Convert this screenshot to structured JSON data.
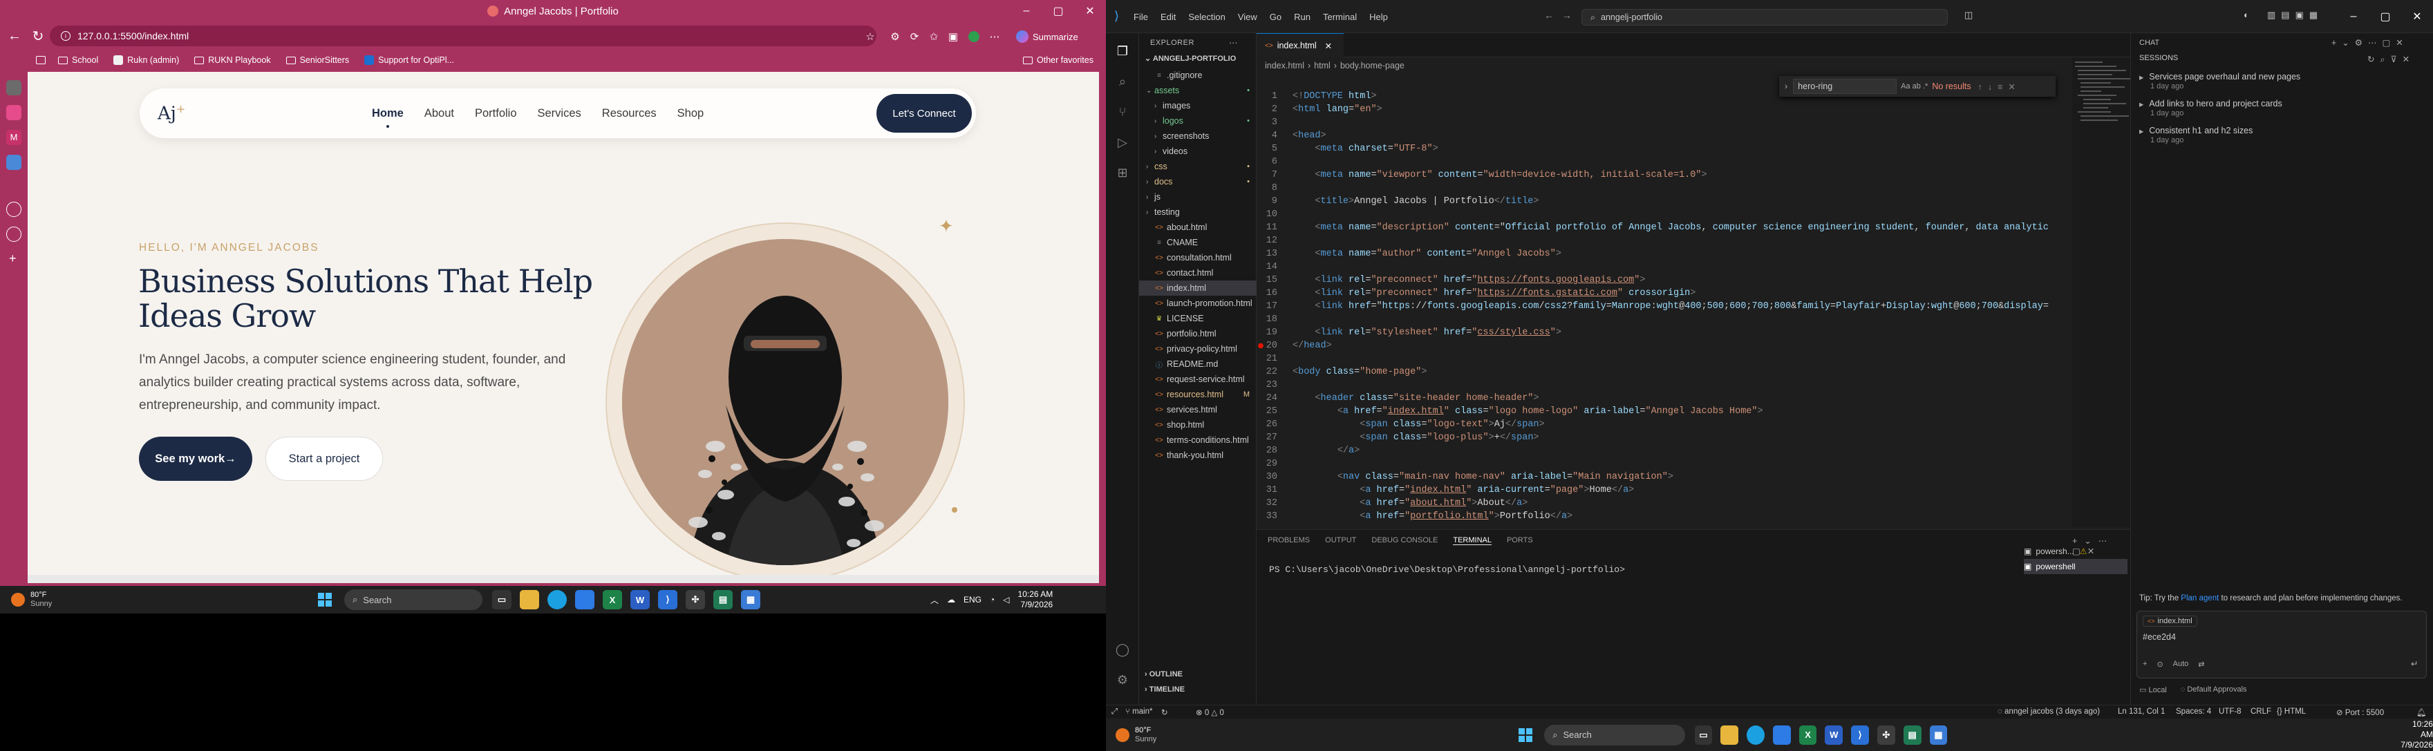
{
  "browser": {
    "window_title": "Anngel Jacobs | Portfolio",
    "url": "127.0.0.1:5500/index.html",
    "summarize_label": "Summarize",
    "bookmarks": [
      "School",
      "Rukn (admin)",
      "RUKN Playbook",
      "SeniorSitters",
      "Support for OptiPl..."
    ],
    "other_favorites": "Other favorites",
    "colors": {
      "frame": "#a8325f",
      "navy": "#1c2a45",
      "gold": "#c9a267"
    }
  },
  "site": {
    "logo": "Aj",
    "logo_plus": "+",
    "nav": [
      "Home",
      "About",
      "Portfolio",
      "Services",
      "Resources",
      "Shop"
    ],
    "cta": "Let's Connect",
    "eyebrow": "HELLO, I'M ANNGEL JACOBS",
    "title": "Business Solutions That Help Ideas Grow",
    "text": "I'm Anngel Jacobs, a computer science engineering student, founder, and analytics builder creating practical systems across data, software, entrepreneurship, and community impact.",
    "primary_button": "See my work→",
    "secondary_button": "Start a project"
  },
  "taskbar_left": {
    "weather_temp": "80°F",
    "weather_desc": "Sunny",
    "search": "Search",
    "lang": "ENG",
    "time": "10:26 AM",
    "date": "7/9/2026"
  },
  "vscode": {
    "menu": [
      "File",
      "Edit",
      "Selection",
      "View",
      "Go",
      "Run",
      "Terminal",
      "Help"
    ],
    "command_center": "anngelj-portfolio",
    "explorer_title": "EXPLORER",
    "project": "ANNGELJ-PORTFOLIO",
    "tree": [
      {
        "name": ".gitignore",
        "depth": 1,
        "type": "file",
        "color": "#cccccc"
      },
      {
        "name": "assets",
        "depth": 1,
        "type": "folder-open",
        "color": "#73c991",
        "badge": "•"
      },
      {
        "name": "images",
        "depth": 2,
        "type": "folder",
        "color": "#cccccc"
      },
      {
        "name": "logos",
        "depth": 2,
        "type": "folder",
        "color": "#73c991",
        "badge": "•"
      },
      {
        "name": "screenshots",
        "depth": 2,
        "type": "folder",
        "color": "#cccccc"
      },
      {
        "name": "videos",
        "depth": 2,
        "type": "folder",
        "color": "#cccccc"
      },
      {
        "name": "css",
        "depth": 1,
        "type": "folder",
        "color": "#e2c08d",
        "badge": "•"
      },
      {
        "name": "docs",
        "depth": 1,
        "type": "folder",
        "color": "#e2c08d",
        "badge": "•"
      },
      {
        "name": "js",
        "depth": 1,
        "type": "folder",
        "color": "#cccccc"
      },
      {
        "name": "testing",
        "depth": 1,
        "type": "folder",
        "color": "#cccccc"
      },
      {
        "name": "about.html",
        "depth": 1,
        "type": "html",
        "color": "#cccccc"
      },
      {
        "name": "CNAME",
        "depth": 1,
        "type": "file",
        "color": "#cccccc"
      },
      {
        "name": "consultation.html",
        "depth": 1,
        "type": "html",
        "color": "#cccccc"
      },
      {
        "name": "contact.html",
        "depth": 1,
        "type": "html",
        "color": "#cccccc"
      },
      {
        "name": "index.html",
        "depth": 1,
        "type": "html",
        "color": "#cccccc",
        "selected": true
      },
      {
        "name": "launch-promotion.html",
        "depth": 1,
        "type": "html",
        "color": "#cccccc"
      },
      {
        "name": "LICENSE",
        "depth": 1,
        "type": "license",
        "color": "#cccccc"
      },
      {
        "name": "portfolio.html",
        "depth": 1,
        "type": "html",
        "color": "#cccccc"
      },
      {
        "name": "privacy-policy.html",
        "depth": 1,
        "type": "html",
        "color": "#cccccc"
      },
      {
        "name": "README.md",
        "depth": 1,
        "type": "md",
        "color": "#cccccc"
      },
      {
        "name": "request-service.html",
        "depth": 1,
        "type": "html",
        "color": "#cccccc"
      },
      {
        "name": "resources.html",
        "depth": 1,
        "type": "html",
        "color": "#e2c08d",
        "badge": "M"
      },
      {
        "name": "services.html",
        "depth": 1,
        "type": "html",
        "color": "#cccccc"
      },
      {
        "name": "shop.html",
        "depth": 1,
        "type": "html",
        "color": "#cccccc"
      },
      {
        "name": "terms-conditions.html",
        "depth": 1,
        "type": "html",
        "color": "#cccccc"
      },
      {
        "name": "thank-you.html",
        "depth": 1,
        "type": "html",
        "color": "#cccccc"
      }
    ],
    "outline": "OUTLINE",
    "timeline": "TIMELINE",
    "tab": "index.html",
    "breadcrumbs": [
      "index.html",
      "html",
      "body.home-page"
    ],
    "find_query": "hero-ring",
    "find_result": "No results",
    "code_lines": [
      "<!DOCTYPE html>",
      "<html lang=\"en\">",
      "",
      "<head>",
      "    <meta charset=\"UTF-8\">",
      "",
      "    <meta name=\"viewport\" content=\"width=device-width, initial-scale=1.0\">",
      "",
      "    <title>Anngel Jacobs | Portfolio</title>",
      "",
      "    <meta name=\"description\" content=\"Official portfolio of Anngel Jacobs, computer science engineering student, founder, data analytic",
      "",
      "    <meta name=\"author\" content=\"Anngel Jacobs\">",
      "",
      "    <link rel=\"preconnect\" href=\"https://fonts.googleapis.com\">",
      "    <link rel=\"preconnect\" href=\"https://fonts.gstatic.com\" crossorigin>",
      "    <link href=\"https://fonts.googleapis.com/css2?family=Manrope:wght@400;500;600;700;800&family=Playfair+Display:wght@600;700&display=",
      "",
      "    <link rel=\"stylesheet\" href=\"css/style.css\">",
      "</head>",
      "",
      "<body class=\"home-page\">",
      "",
      "    <header class=\"site-header home-header\">",
      "        <a href=\"index.html\" class=\"logo home-logo\" aria-label=\"Anngel Jacobs Home\">",
      "            <span class=\"logo-text\">Aj</span>",
      "            <span class=\"logo-plus\">+</span>",
      "        </a>",
      "",
      "        <nav class=\"main-nav home-nav\" aria-label=\"Main navigation\">",
      "            <a href=\"index.html\" aria-current=\"page\">Home</a>",
      "            <a href=\"about.html\">About</a>",
      "            <a href=\"portfolio.html\">Portfolio</a>"
    ],
    "panel_tabs": [
      "PROBLEMS",
      "OUTPUT",
      "DEBUG CONSOLE",
      "TERMINAL",
      "PORTS"
    ],
    "terminal_prompt": "PS C:\\Users\\jacob\\OneDrive\\Desktop\\Professional\\anngelj-portfolio>",
    "terminals": [
      "powersh...",
      "powershell"
    ],
    "chat": {
      "title": "CHAT",
      "sessions_label": "SESSIONS",
      "sessions": [
        {
          "title": "Services page overhaul and new pages",
          "time": "1 day ago"
        },
        {
          "title": "Add links to hero and project cards",
          "time": "1 day ago"
        },
        {
          "title": "Consistent h1 and h2 sizes",
          "time": "1 day ago"
        }
      ],
      "tip_prefix": "Tip: Try the",
      "tip_link": "Plan agent",
      "tip_suffix": "to research and plan before implementing changes.",
      "attached_file": "index.html",
      "input_text": "#ece2d4",
      "mode": "Auto",
      "local_label": "Local",
      "approvals_label": "Default Approvals"
    },
    "status": {
      "branch": "main*",
      "problems": "0 △ 0",
      "author": "anngel jacobs (3 days ago)",
      "position": "Ln 131, Col 1",
      "spaces": "Spaces: 4",
      "encoding": "UTF-8",
      "eol": "CRLF",
      "lang": "HTML",
      "port": "Port : 5500"
    }
  },
  "taskbar_right": {
    "weather_temp": "80°F",
    "weather_desc": "Sunny",
    "search": "Search",
    "time": "10:26 AM",
    "date": "7/9/2026"
  }
}
